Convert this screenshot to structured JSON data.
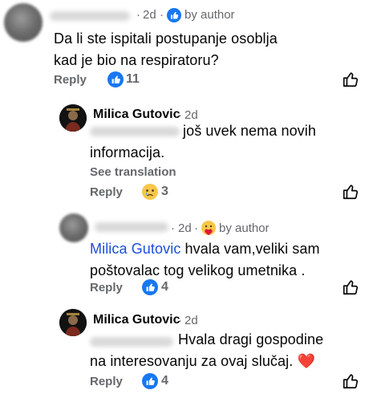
{
  "comments": [
    {
      "time": "2d",
      "badge": "by author",
      "text": "Da li ste ispitali postupanje osoblja kad je bio na respiratoru?",
      "reply_label": "Reply",
      "reaction_count": "11",
      "reaction_icon": "like-reaction-icon"
    },
    {
      "author": "Milica Gutovic",
      "time": "2d",
      "text": "još uvek nema novih informacija.",
      "see_translation": "See translation",
      "reply_label": "Reply",
      "reaction_count": "3",
      "reaction_icon": "sad-reaction-icon"
    },
    {
      "time": "2d",
      "badge": "by author",
      "mention": "Milica Gutovic",
      "text": "hvala vam,veliki sam poštovalac tog velikog umetnika .",
      "reply_label": "Reply",
      "reaction_count": "4",
      "reaction_icon": "like-reaction-icon"
    },
    {
      "author": "Milica Gutovic",
      "time": "2d",
      "text": "Hvala dragi gospodine na interesovanju za ovaj slučaj.",
      "emoji": "❤️",
      "reply_label": "Reply",
      "reaction_count": "4",
      "reaction_icon": "like-reaction-icon"
    }
  ],
  "colors": {
    "meta_gray": "#65676b",
    "facebook_blue": "#1877f2",
    "mention_blue": "#1d4ed8",
    "heart_red": "#e0193a"
  }
}
